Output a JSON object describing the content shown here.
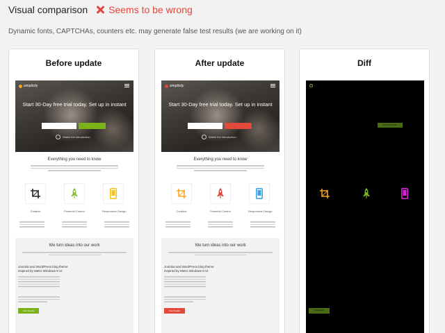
{
  "header": {
    "title": "Visual comparison",
    "status": "Seems to be wrong",
    "status_color": "#e2453b"
  },
  "note": "Dynamic fonts, CAPTCHAs, counters etc. may generate false test results (we are working on it)",
  "panels": [
    {
      "title": "Before update",
      "accent": "#7ab317"
    },
    {
      "title": "After update",
      "accent": "#e2493b"
    },
    {
      "title": "Diff"
    }
  ],
  "page": {
    "logo": "simplicity",
    "hero_heading": "Start 30-Day free trial today. Set up in instant",
    "cta": "Get Started today!",
    "watch": "Watch the introduction",
    "section1": "Everything you need to know",
    "features": [
      "Creative",
      "Powerful Control",
      "Responsive Design"
    ],
    "section2": "We turn ideas into our work",
    "blog_title_line1": "Joomla! and WordPress blog theme",
    "blog_title_line2": "inspired by Metro Windows 8 UI",
    "details_btn": "View Details"
  },
  "icons": {
    "before": {
      "crop": "#222222",
      "rocket": "#8bc34a",
      "phone": "#f5c518"
    },
    "after": {
      "crop": "#f5a623",
      "rocket": "#e2493b",
      "phone": "#3aa3e3"
    },
    "diff": {
      "crop": "#f5a623",
      "rocket": "#7ab317",
      "phone": "#e01ee0"
    }
  }
}
